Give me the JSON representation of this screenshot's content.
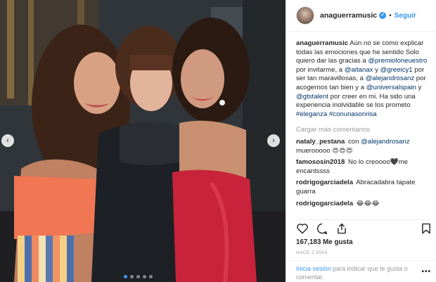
{
  "post": {
    "username": "anaguerramusic",
    "verified_icon": "verified-badge-icon",
    "separator": "•",
    "follow_label": "Seguir"
  },
  "caption": {
    "username": "anaguerramusic",
    "t1": " Aún no se como explicar todas las emociones que he sentido Solo quiero dar las gracias a ",
    "m1": "@premioloneuestro",
    "t2": " por invitarme, a ",
    "m2": "@aitanax",
    "t3": " y ",
    "m3": "@greeicy1",
    "t4": " por ser tan maravillosas, a ",
    "m4": "@alejandrosanz",
    "t5": " por acogernos tan bien y a ",
    "m5": "@universalspain",
    "t6": " y ",
    "m6": "@gtstalent",
    "t7": " por creer en mi. Ha sido una experiencia inolvidable se los prometo ",
    "h1": "#eleganza",
    "t8": " ",
    "h2": "#conunasonrisa"
  },
  "load_more_label": "Cargar más comentarios",
  "comments": [
    {
      "user": "nataly_pestana",
      "t1": "con ",
      "m1": "@alejandrosanz",
      "t2": " muerooooo ",
      "emoji": "😍😍😍"
    },
    {
      "user": "famososin2018",
      "t1": "No lo creoooo🖤me encantssss"
    },
    {
      "user": "rodrigogarciadela",
      "t1": "Abracadabra tapate guarra"
    },
    {
      "user": "rodrigogarciadela",
      "emoji": "😂😂😂"
    }
  ],
  "actions": {
    "like_icon": "heart-icon",
    "comment_icon": "comment-icon",
    "share_icon": "share-icon",
    "save_icon": "bookmark-icon"
  },
  "likes_label": "167,183 Me gusta",
  "time_label": "HACE 2 DÍAS",
  "login": {
    "link": "Inicia sesión",
    "text": " para indicar que te gusta o comentar.",
    "more_label": "•••"
  },
  "carousel": {
    "prev_label": "‹",
    "next_label": "›",
    "slide_count": 5,
    "active_slide": 1
  },
  "colors": {
    "link": "#003569",
    "accent": "#3897f0",
    "muted": "#999999"
  }
}
